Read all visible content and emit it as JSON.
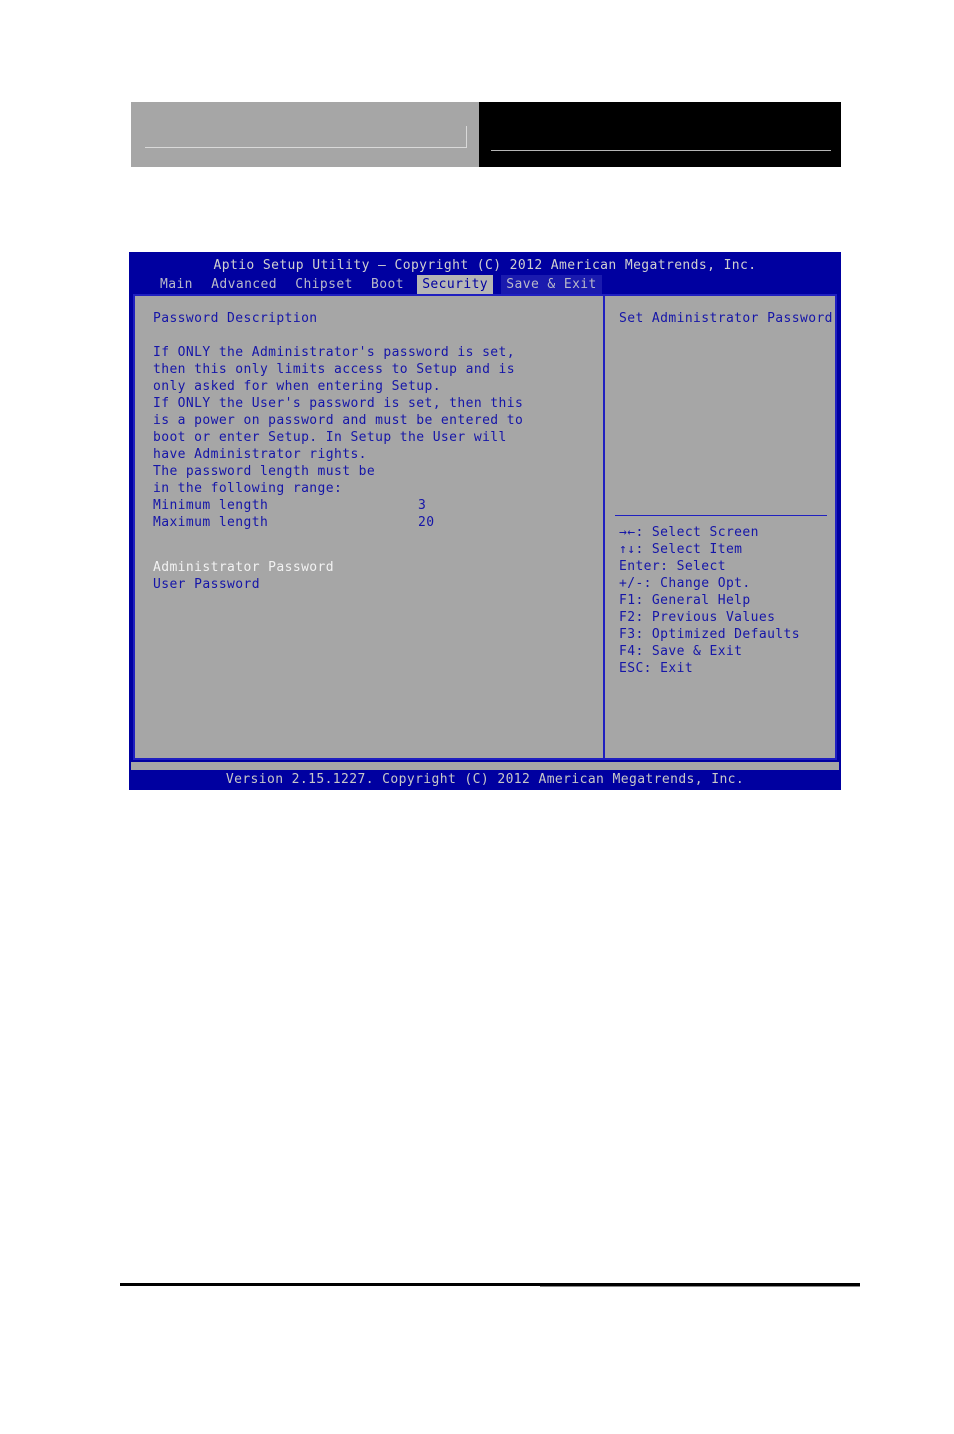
{
  "header": {
    "gray_box": "",
    "black_box": ""
  },
  "bios": {
    "title": "Aptio Setup Utility – Copyright (C) 2012 American Megatrends, Inc.",
    "menu": [
      {
        "label": "Main",
        "state": "normal"
      },
      {
        "label": "Advanced",
        "state": "normal"
      },
      {
        "label": "Chipset",
        "state": "normal"
      },
      {
        "label": "Boot",
        "state": "normal"
      },
      {
        "label": "Security",
        "state": "active"
      },
      {
        "label": "Save & Exit",
        "state": "dim"
      }
    ],
    "left_pane": {
      "heading": "Password Description",
      "description_lines": [
        "If ONLY the Administrator's password is set,",
        "then this only limits access to Setup and is",
        "only asked for when entering Setup.",
        "If ONLY the User's password is set, then this",
        "is a power on password and must be entered to",
        "boot or enter Setup. In Setup the User will",
        "have Administrator rights.",
        "The password length must be",
        "in the following range:"
      ],
      "length_rows": [
        {
          "key": "Minimum length",
          "value": "3"
        },
        {
          "key": "Maximum length",
          "value": "20"
        }
      ],
      "password_items": [
        {
          "label": "Administrator Password",
          "selected": true
        },
        {
          "label": "User Password",
          "selected": false
        }
      ]
    },
    "right_pane": {
      "help_text": "Set Administrator Password",
      "keys": [
        "→←: Select Screen",
        "↑↓: Select Item",
        "Enter: Select",
        "+/-: Change Opt.",
        "F1: General Help",
        "F2: Previous Values",
        "F3: Optimized Defaults",
        "F4: Save & Exit",
        "ESC: Exit"
      ]
    },
    "footer": "Version 2.15.1227. Copyright (C) 2012 American Megatrends, Inc."
  },
  "colors": {
    "bios_blue": "#0000a0",
    "panel_gray": "#a6a6a6",
    "text_blue": "#1515a8",
    "text_white": "#f2f2f2",
    "highlight_gray": "#b5b5b5"
  }
}
